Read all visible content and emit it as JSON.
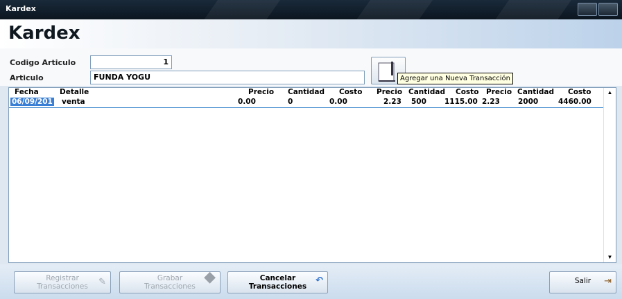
{
  "window": {
    "title": "Kardex"
  },
  "header": {
    "title": "Kardex"
  },
  "form": {
    "codigo_label": "Codigo Articulo",
    "codigo_value": "1",
    "articulo_label": "Articulo",
    "articulo_value": "FUNDA YOGU",
    "add_tooltip": "Agregar una Nueva Transacción"
  },
  "grid": {
    "columns": [
      "Fecha",
      "Detalle",
      "Precio",
      "Cantidad",
      "Costo",
      "Precio",
      "Cantidad",
      "Costo",
      "Precio",
      "Cantidad",
      "Costo"
    ],
    "rows": [
      [
        "06/09/201",
        "venta",
        "0.00",
        "0",
        "0.00",
        "2.23",
        "500",
        "1115.00",
        "2.23",
        "2000",
        "4460.00"
      ]
    ]
  },
  "footer": {
    "registrar_l1": "Registrar",
    "registrar_l2": "Transacciones",
    "grabar_l1": "Grabar",
    "grabar_l2": "Transacciones",
    "cancelar_l1": "Cancelar",
    "cancelar_l2": "Transacciones",
    "salir": "Salir"
  }
}
